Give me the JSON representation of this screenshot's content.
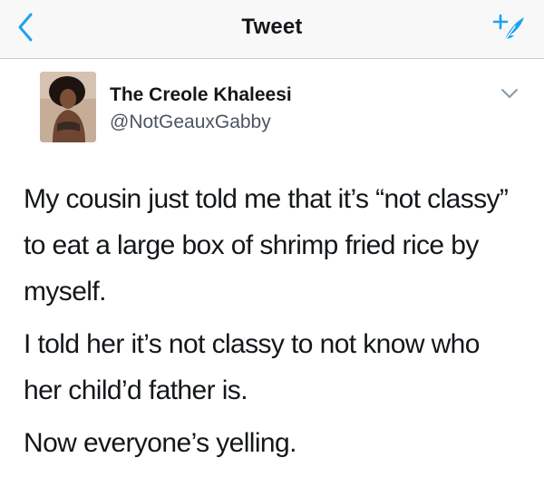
{
  "nav": {
    "title": "Tweet",
    "back_icon": "chevron-left-icon",
    "compose_icon": "compose-feather-icon",
    "accent": "#1da1f2"
  },
  "tweet": {
    "author_name": "The Creole Khaleesi",
    "author_handle": "@NotGeauxGabby",
    "menu_icon": "chevron-down-icon",
    "paragraphs": [
      "My cousin just told me that it’s “not classy” to eat a large box of shrimp fried rice by myself.",
      "I told her it’s not classy to not know who her child’d father is.",
      "Now everyone’s yelling."
    ]
  }
}
